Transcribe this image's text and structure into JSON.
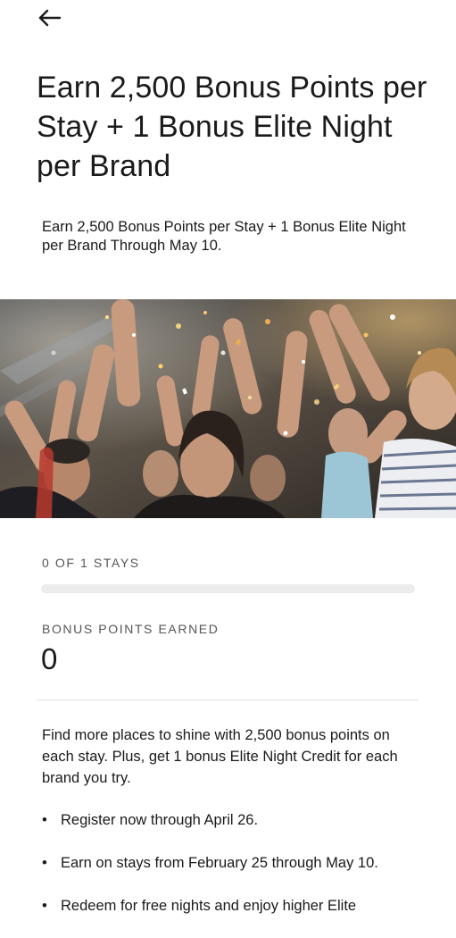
{
  "header": {
    "back_icon": "arrow-left-icon"
  },
  "offer": {
    "title": "Earn 2,500 Bonus Points per Stay + 1 Bonus Elite Night per Brand",
    "subtitle": "Earn 2,500 Bonus Points per Stay + 1 Bonus Elite Night per Brand Through May 10."
  },
  "hero": {
    "image_subject": "cheering-crowd-with-confetti"
  },
  "progress": {
    "label": "0 OF 1 STAYS",
    "fraction": 0
  },
  "bonus": {
    "label": "BONUS POINTS EARNED",
    "value": "0"
  },
  "details": {
    "description": "Find more places to shine with 2,500 bonus points on each stay. Plus, get 1 bonus Elite Night Credit for each brand you try.",
    "bullet_symbol": "•",
    "bullets": [
      "Register now through April 26.",
      "Earn on stays from February 25 through May 10.",
      "Redeem for free nights and enjoy higher Elite"
    ]
  },
  "colors": {
    "text": "#1a1a1a",
    "label": "#555555",
    "track": "#ececec",
    "divider": "#e3e3e3"
  }
}
